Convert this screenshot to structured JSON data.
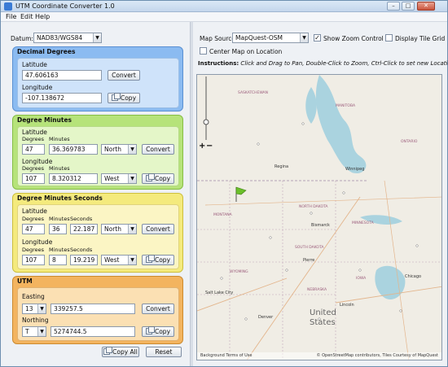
{
  "window": {
    "title": "UTM Coordinate Converter 1.0",
    "min": "–",
    "max": "□",
    "close": "✕"
  },
  "menu": {
    "file": "File",
    "edit": "Edit",
    "help": "Help"
  },
  "datum": {
    "label": "Datum:",
    "value": "NAD83/WGS84"
  },
  "decimal": {
    "title": "Decimal Degrees",
    "lat_label": "Latitude",
    "lat_value": "47.606163",
    "lon_label": "Longitude",
    "lon_value": "-107.138672",
    "convert": "Convert",
    "copy": "Copy"
  },
  "dm": {
    "title": "Degree Minutes",
    "lat_label": "Latitude",
    "deg_label": "Degrees",
    "min_label": "Minutes",
    "lat_deg": "47",
    "lat_min": "36.369783",
    "lat_dir": "North",
    "lon_label": "Longitude",
    "lon_deg": "107",
    "lon_min": "8.320312",
    "lon_dir": "West",
    "convert": "Convert",
    "copy": "Copy"
  },
  "dms": {
    "title": "Degree Minutes Seconds",
    "lat_label": "Latitude",
    "deg_label": "Degrees",
    "min_label": "Minutes",
    "sec_label": "Seconds",
    "lat_deg": "47",
    "lat_min": "36",
    "lat_sec": "22.187",
    "lat_dir": "North",
    "lon_label": "Longitude",
    "lon_deg": "107",
    "lon_min": "8",
    "lon_sec": "19.219",
    "lon_dir": "West",
    "convert": "Convert",
    "copy": "Copy"
  },
  "utm": {
    "title": "UTM",
    "east_label": "Easting",
    "zone": "13",
    "easting": "339257.5",
    "north_label": "Northing",
    "band": "T",
    "northing": "5274744.5",
    "convert": "Convert",
    "copy": "Copy"
  },
  "bottom": {
    "copy_all": "Copy All",
    "reset": "Reset"
  },
  "map": {
    "source_label": "Map Source:",
    "source_value": "MapQuest-OSM",
    "show_zoom": "Show Zoom Control",
    "show_zoom_checked": true,
    "tile_grid": "Display Tile Grid",
    "tile_grid_checked": false,
    "center": "Center Map on Location",
    "center_checked": false,
    "instructions_bold": "Instructions:",
    "instructions_text": " Click and Drag to Pan, Double-Click to Zoom, Ctrl-Click to set new Location.",
    "labels": {
      "saskatchewan": "SASKATCHEWAN",
      "manitoba": "MANITOBA",
      "ontario": "ONTARIO",
      "montana": "MONTANA",
      "north_dakota": "NORTH DAKOTA",
      "south_dakota": "SOUTH DAKOTA",
      "minnesota": "MINNESOTA",
      "wyoming": "WYOMING",
      "nebraska": "NEBRASKA",
      "iowa": "IOWA",
      "united": "United",
      "states": "States",
      "winnipeg": "Winnipeg",
      "regina": "Regina",
      "bismarck": "Bismarck",
      "pierre": "Pierre",
      "lincoln": "Lincoln",
      "denver": "Denver",
      "chicago": "Chicago",
      "salt_lake": "Salt Lake City"
    },
    "attribution_left": "Background Terms of Use",
    "attribution_right": "© OpenStreetMap contributors, Tiles Courtesy of MapQuest",
    "colors": {
      "water": "#aad3df",
      "land": "#f0ede5",
      "marker": "#6bbf2a"
    }
  }
}
